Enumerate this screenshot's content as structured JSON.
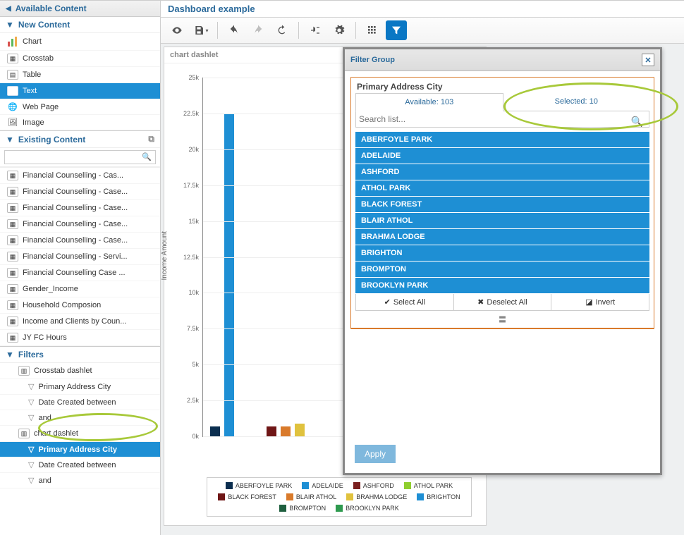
{
  "sidebar": {
    "title": "Available Content",
    "new_content": {
      "label": "New Content",
      "items": [
        {
          "label": "Chart",
          "icon": "chart-icon"
        },
        {
          "label": "Crosstab",
          "icon": "crosstab-icon"
        },
        {
          "label": "Table",
          "icon": "table-icon"
        },
        {
          "label": "Text",
          "icon": "text-icon",
          "selected": true
        },
        {
          "label": "Web Page",
          "icon": "globe-icon"
        },
        {
          "label": "Image",
          "icon": "image-icon"
        }
      ]
    },
    "existing_content": {
      "label": "Existing Content",
      "search_placeholder": "",
      "items": [
        "Financial Counselling - Cas...",
        "Financial Counselling - Case...",
        "Financial Counselling - Case...",
        "Financial Counselling - Case...",
        "Financial Counselling - Case...",
        "Financial Counselling - Servi...",
        "Financial Counselling Case ...",
        "Gender_Income",
        "Household Composion",
        "Income and Clients by Coun...",
        "JY FC Hours"
      ]
    },
    "filters": {
      "label": "Filters",
      "groups": [
        {
          "name": "Crosstab dashlet",
          "children": [
            "Primary Address City",
            "Date Created between",
            "and"
          ]
        },
        {
          "name": "chart dashlet",
          "children": [
            {
              "label": "Primary Address City",
              "selected": true
            },
            "Date Created between",
            "and"
          ]
        }
      ]
    }
  },
  "main": {
    "title": "Dashboard example",
    "toolbar": [
      "preview",
      "save",
      "divider",
      "undo",
      "redo",
      "refresh",
      "divider",
      "input-link",
      "settings",
      "divider",
      "grid",
      "filter"
    ],
    "dashlet_title": "chart dashlet",
    "chart_ylabel": "Income Amount",
    "chart_xlabel": "Income Amou"
  },
  "chart_data": {
    "type": "bar",
    "categories": [
      "ABERFOYLE PARK",
      "ADELAIDE",
      "ASHFORD",
      "ATHOL PARK",
      "BLACK FOREST",
      "BLAIR ATHOL",
      "BRAHMA LODGE",
      "BRIGHTON",
      "BROMPTON",
      "BROOKLYN PARK"
    ],
    "values": [
      700,
      22500,
      0,
      0,
      700,
      700,
      900,
      0,
      0,
      0
    ],
    "colors": [
      "#0b2e4f",
      "#1e8fd4",
      "#7a1f1f",
      "#8fce2e",
      "#6f1616",
      "#d97a2b",
      "#e0c23e",
      "#1e8fd4",
      "#1f5f3f",
      "#2e9a4f"
    ],
    "ylabel": "Income Amount",
    "ylim": [
      0,
      25000
    ],
    "yticks": [
      0,
      2500,
      5000,
      7500,
      10000,
      12500,
      15000,
      17500,
      20000,
      22500,
      25000
    ],
    "ytick_labels": [
      "0k",
      "2.5k",
      "5k",
      "7.5k",
      "10k",
      "12.5k",
      "15k",
      "17.5k",
      "20k",
      "22.5k",
      "25k"
    ]
  },
  "popup": {
    "title": "Filter Group",
    "field_label": "Primary Address City",
    "tabs": {
      "available": "Available: 103",
      "selected": "Selected: 10"
    },
    "search_placeholder": "Search list...",
    "options": [
      "ABERFOYLE PARK",
      "ADELAIDE",
      "ASHFORD",
      "ATHOL PARK",
      "BLACK FOREST",
      "BLAIR ATHOL",
      "BRAHMA LODGE",
      "BRIGHTON",
      "BROMPTON",
      "BROOKLYN PARK"
    ],
    "actions": {
      "select_all": "Select All",
      "deselect_all": "Deselect All",
      "invert": "Invert"
    },
    "apply": "Apply"
  }
}
